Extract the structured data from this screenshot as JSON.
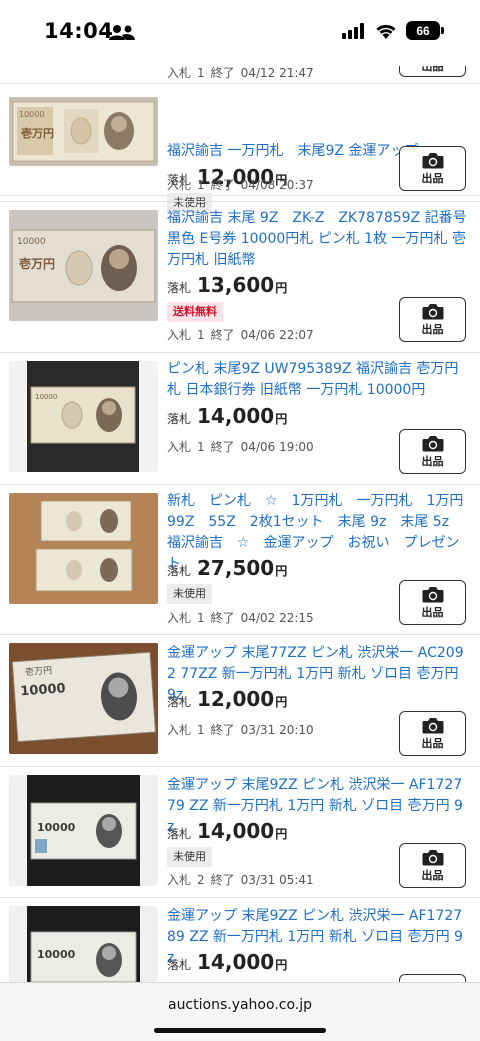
{
  "status": {
    "time": "14:04",
    "battery": "66"
  },
  "browser": {
    "url": "auctions.yahoo.co.jp"
  },
  "labels": {
    "price_label": "落札",
    "yen": "円",
    "bids_label": "入札",
    "end_label": "終了",
    "sell_button": "出品"
  },
  "items": [
    {
      "title": "",
      "price": "",
      "badge": "",
      "bids": "1",
      "end": "04/12 21:47"
    },
    {
      "title": "福沢諭吉 一万円札　末尾9Z 金運アップ",
      "price": "12,000",
      "badge": "未使用",
      "bids": "1",
      "end": "04/08 20:37"
    },
    {
      "title": "福沢諭吉 末尾 9Z　ZK-Z　ZK787859Z 記番号 黒色 E号券 10000円札 ピン札 1枚 一万円札 壱万円札 旧紙幣",
      "price": "13,600",
      "badge": "送料無料",
      "bids": "1",
      "end": "04/06 22:07"
    },
    {
      "title": "ピン札 末尾9Z UW795389Z 福沢諭吉 壱万円札 日本銀行券 旧紙幣 一万円札 10000円",
      "price": "14,000",
      "badge": "",
      "bids": "1",
      "end": "04/06 19:00"
    },
    {
      "title": "新札　ピン札　☆　1万円札　一万円札　1万円 99Z　55Z　2枚1セット　末尾 9z　末尾 5z　福沢諭吉　☆　金運アップ　お祝い　プレゼント",
      "price": "27,500",
      "badge": "未使用",
      "bids": "1",
      "end": "04/02 22:15"
    },
    {
      "title": "金運アップ 末尾77ZZ ピン札 渋沢栄一 AC2092 77ZZ 新一万円札 1万円 新札 ゾロ目 壱万円 9z",
      "price": "12,000",
      "badge": "",
      "bids": "1",
      "end": "03/31 20:10"
    },
    {
      "title": "金運アップ 末尾9ZZ ピン札 渋沢栄一 AF172779 ZZ 新一万円札 1万円 新札 ゾロ目 壱万円 9z",
      "price": "14,000",
      "badge": "未使用",
      "bids": "2",
      "end": "03/31 05:41"
    },
    {
      "title": "金運アップ 末尾9ZZ ピン札 渋沢栄一 AF172789 ZZ 新一万円札 1万円 新札 ゾロ目 壱万円 9z",
      "price": "14,000",
      "badge": "",
      "bids": "",
      "end": ""
    }
  ],
  "colors": {
    "link": "#1f6fc5",
    "free_shipping": "#d0112b"
  }
}
